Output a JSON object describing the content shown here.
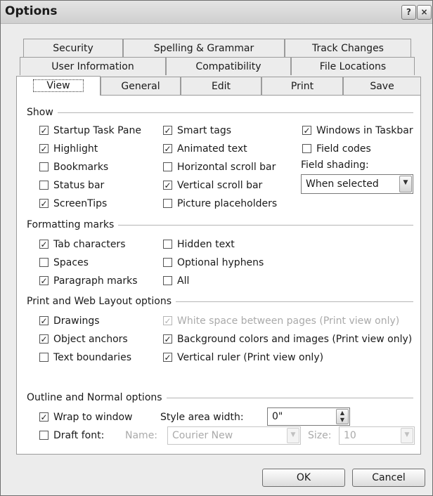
{
  "window": {
    "title": "Options"
  },
  "titlebar_buttons": {
    "help": "?",
    "close": "×"
  },
  "tabs": {
    "row1": [
      "Security",
      "Spelling & Grammar",
      "Track Changes"
    ],
    "row2": [
      "User Information",
      "Compatibility",
      "File Locations"
    ],
    "row3": [
      "View",
      "General",
      "Edit",
      "Print",
      "Save"
    ],
    "selected": "View"
  },
  "show": {
    "heading": "Show",
    "items": [
      {
        "label": "Startup Task Pane",
        "checked": true
      },
      {
        "label": "Highlight",
        "checked": true
      },
      {
        "label": "Bookmarks",
        "checked": false
      },
      {
        "label": "Status bar",
        "checked": false
      },
      {
        "label": "ScreenTips",
        "checked": true
      },
      {
        "label": "Smart tags",
        "checked": true
      },
      {
        "label": "Animated text",
        "checked": true
      },
      {
        "label": "Horizontal scroll bar",
        "checked": false
      },
      {
        "label": "Vertical scroll bar",
        "checked": true
      },
      {
        "label": "Picture placeholders",
        "checked": false
      },
      {
        "label": "Windows in Taskbar",
        "checked": true
      },
      {
        "label": "Field codes",
        "checked": false
      }
    ],
    "field_shading_label": "Field shading:",
    "field_shading_value": "When selected"
  },
  "formatting": {
    "heading": "Formatting marks",
    "items": [
      {
        "label": "Tab characters",
        "checked": true
      },
      {
        "label": "Spaces",
        "checked": false
      },
      {
        "label": "Paragraph marks",
        "checked": true
      },
      {
        "label": "Hidden text",
        "checked": false
      },
      {
        "label": "Optional hyphens",
        "checked": false
      },
      {
        "label": "All",
        "checked": false
      }
    ]
  },
  "print_web": {
    "heading": "Print and Web Layout options",
    "items": [
      {
        "label": "Drawings",
        "checked": true
      },
      {
        "label": "Object anchors",
        "checked": true
      },
      {
        "label": "Text boundaries",
        "checked": false
      },
      {
        "label": "White space between pages (Print view only)",
        "checked": true,
        "disabled": true
      },
      {
        "label": "Background colors and images (Print view only)",
        "checked": true
      },
      {
        "label": "Vertical ruler (Print view only)",
        "checked": true
      }
    ]
  },
  "outline": {
    "heading": "Outline and Normal options",
    "items": [
      {
        "label": "Wrap to window",
        "checked": true
      },
      {
        "label": "Draft font:",
        "checked": false
      }
    ],
    "style_area_label": "Style area width:",
    "style_area_value": "0\"",
    "name_label": "Name:",
    "name_value": "Courier New",
    "size_label": "Size:",
    "size_value": "10"
  },
  "buttons": {
    "ok": "OK",
    "cancel": "Cancel"
  }
}
